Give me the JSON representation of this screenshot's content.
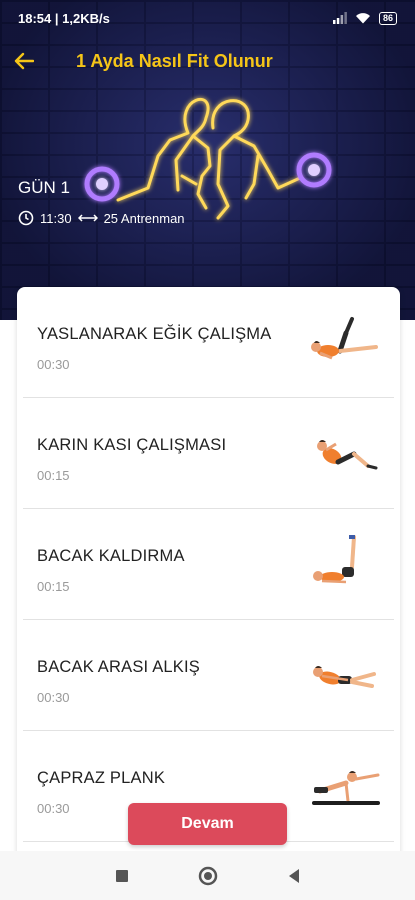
{
  "status_bar": {
    "time": "18:54",
    "network_speed": "1,2KB/s",
    "battery": "86"
  },
  "header": {
    "title": "1 Ayda Nasıl Fit Olunur",
    "day_label": "GÜN 1",
    "duration": "11:30",
    "workout_count": "25 Antrenman"
  },
  "exercises": [
    {
      "name": "YASLANARAK EĞİK ÇALIŞMA",
      "duration": "00:30"
    },
    {
      "name": "KARIN KASI ÇALIŞMASI",
      "duration": "00:15"
    },
    {
      "name": "BACAK KALDIRMA",
      "duration": "00:15"
    },
    {
      "name": "BACAK ARASI ALKIŞ",
      "duration": "00:30"
    },
    {
      "name": "ÇAPRAZ PLANK",
      "duration": "00:30"
    }
  ],
  "continue_label": "Devam",
  "colors": {
    "accent_yellow": "#f5c518",
    "button_red": "#dc4a5b",
    "header_bg": "#1b1f4e"
  }
}
